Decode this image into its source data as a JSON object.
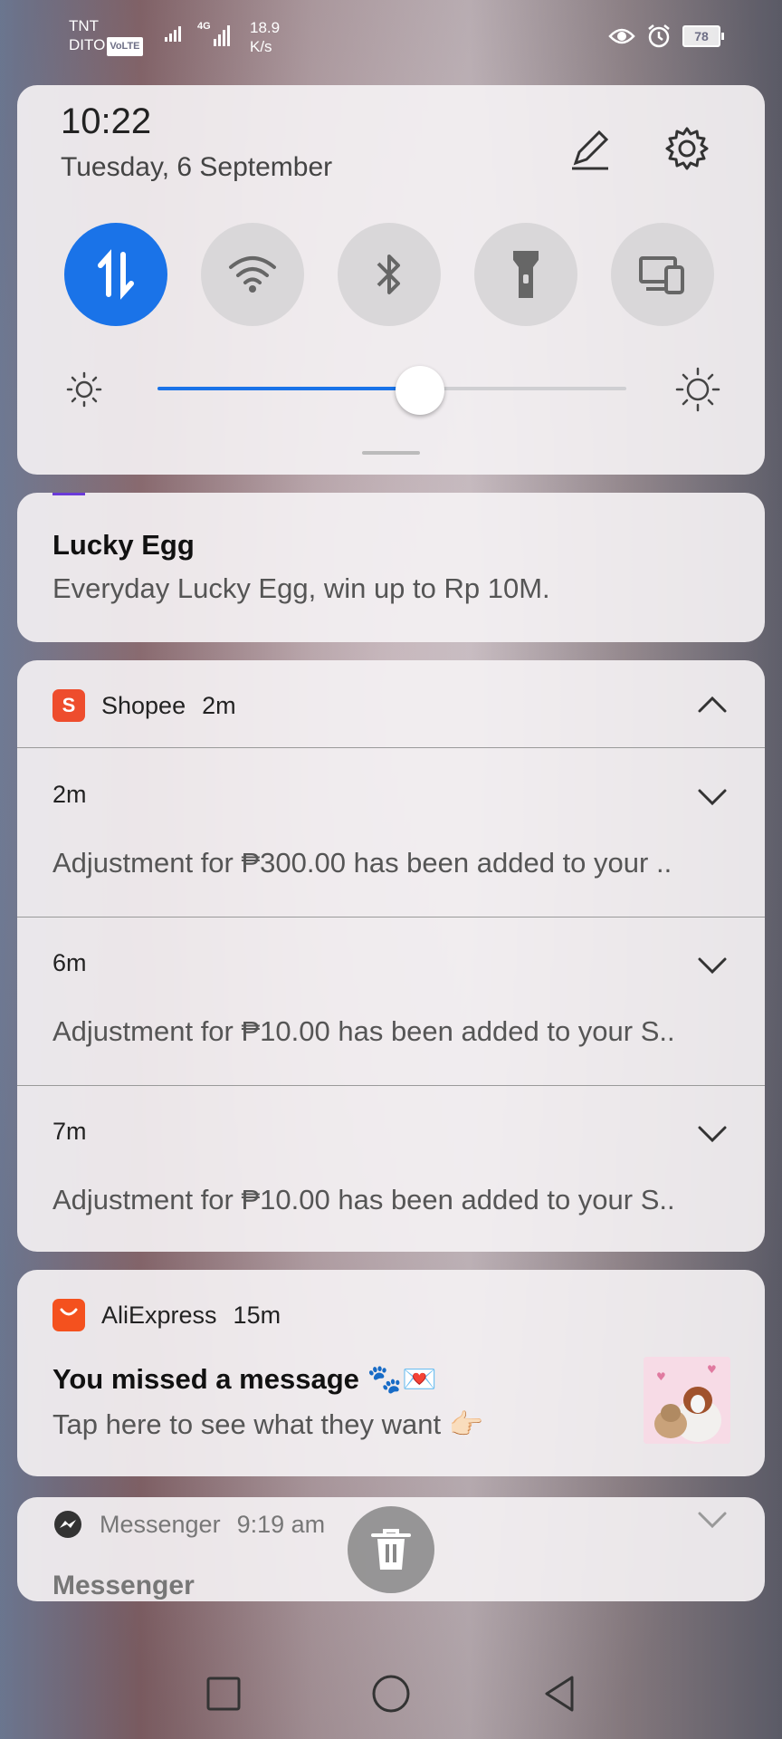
{
  "status_bar": {
    "carrier1": "TNT",
    "carrier2": "DITO",
    "volte": "VoLTE",
    "network": "4G",
    "speed_value": "18.9",
    "speed_unit": "K/s",
    "battery": "78",
    "icons": [
      "eye-icon",
      "alarm-icon",
      "battery-icon"
    ]
  },
  "quick_settings": {
    "time": "10:22",
    "date": "Tuesday, 6 September",
    "edit_icon": "pencil-icon",
    "settings_icon": "gear-icon",
    "toggles": [
      {
        "name": "mobile-data",
        "icon": "data-arrows-icon",
        "on": true
      },
      {
        "name": "wifi",
        "icon": "wifi-icon",
        "on": false
      },
      {
        "name": "bluetooth",
        "icon": "bluetooth-icon",
        "on": false
      },
      {
        "name": "flashlight",
        "icon": "flashlight-icon",
        "on": false
      },
      {
        "name": "device-connect",
        "icon": "devices-icon",
        "on": false
      }
    ],
    "brightness_level": 0.56,
    "accent": "#1a73e8"
  },
  "notifications": {
    "lucky": {
      "title": "Lucky Egg",
      "body": "Everyday Lucky Egg, win up to Rp 10M."
    },
    "shopee": {
      "app": "Shopee",
      "time": "2m",
      "icon_letter": "S",
      "brand_color": "#ee4d2d",
      "items": [
        {
          "time": "2m",
          "body": "Adjustment for ₱300.00 has been added to your .."
        },
        {
          "time": "6m",
          "body": "Adjustment for ₱10.00 has been added to your S.."
        },
        {
          "time": "7m",
          "body": "Adjustment for ₱10.00 has been added to your S.."
        }
      ]
    },
    "aliexpress": {
      "app": "AliExpress",
      "time": "15m",
      "brand_color": "#f4511e",
      "title": "You missed a message 🐾💌",
      "body": "Tap here to see what they want 👉🏻"
    },
    "messenger": {
      "app": "Messenger",
      "time": "9:19 am",
      "title": "Messenger"
    }
  },
  "nav": {
    "icons": [
      "recents-square-icon",
      "home-circle-icon",
      "back-triangle-icon"
    ]
  }
}
